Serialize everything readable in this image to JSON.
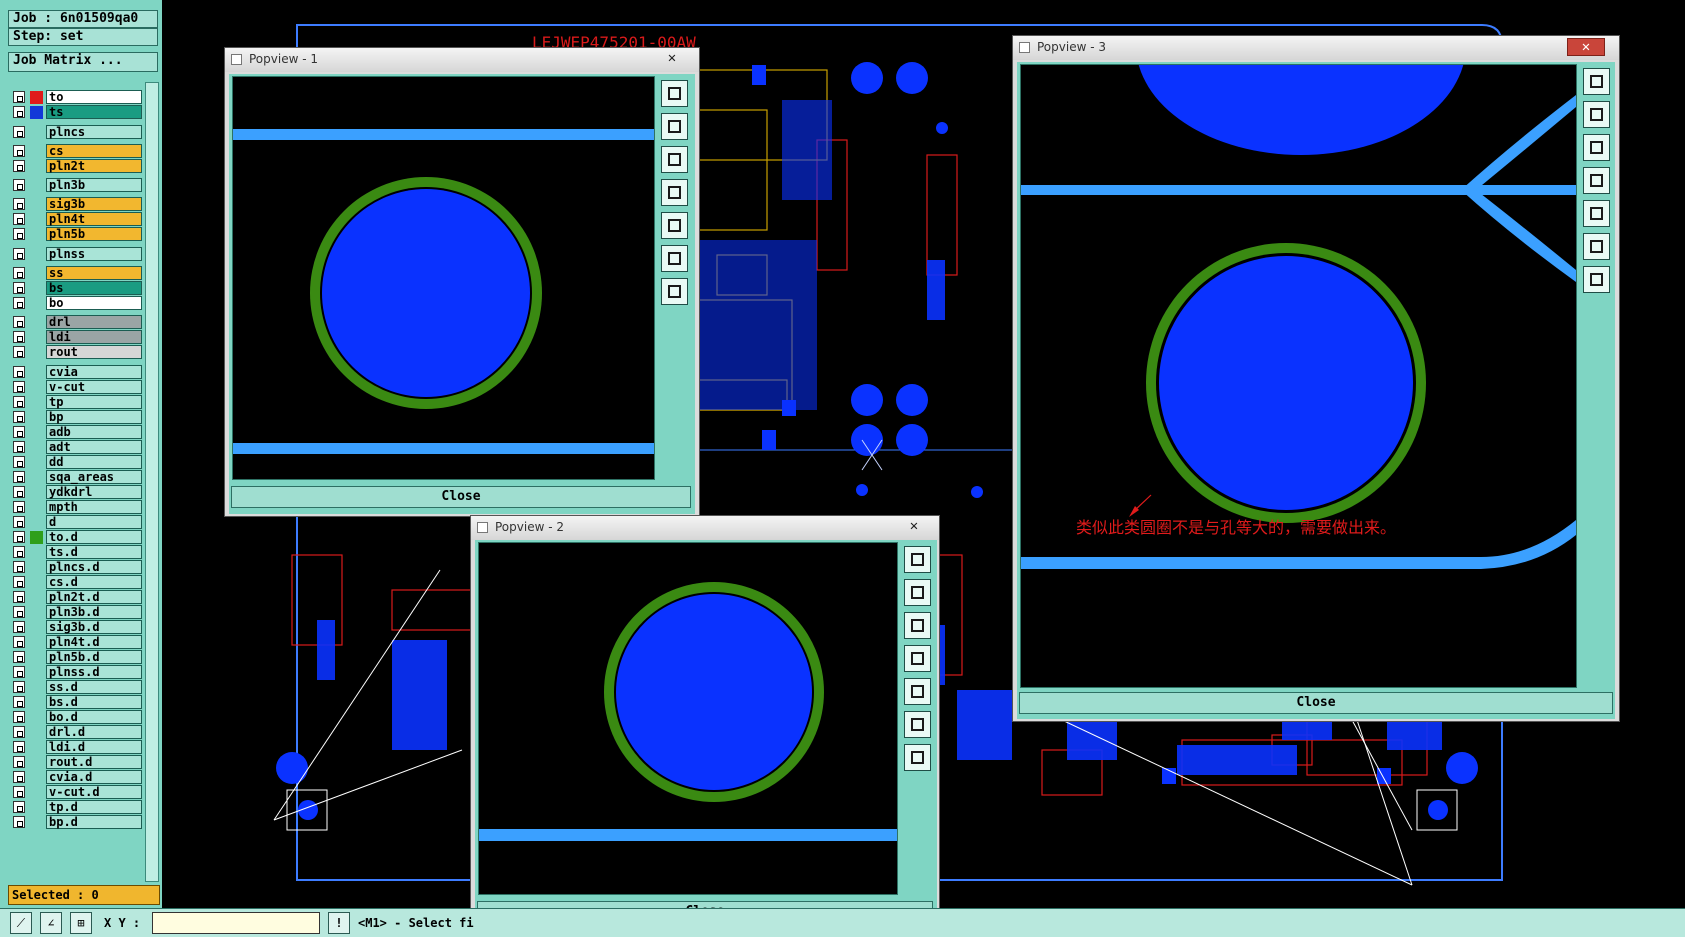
{
  "job": {
    "label": "Job : 6n01509qa0",
    "step": "Step: set",
    "matrix_button": "Job Matrix ..."
  },
  "layers": [
    {
      "name": "to",
      "color": "#ffffff",
      "swatch": "#e01b1b"
    },
    {
      "name": "ts",
      "color": "#1a9c82",
      "swatch": "#1238d8"
    },
    {
      "name": "plncs",
      "color": "#a9e4d7",
      "swatch": ""
    },
    {
      "name": "cs",
      "color": "#f2b72f",
      "swatch": ""
    },
    {
      "name": "pln2t",
      "color": "#f2b72f",
      "swatch": ""
    },
    {
      "name": "pln3b",
      "color": "#a9e4d7",
      "swatch": ""
    },
    {
      "name": "sig3b",
      "color": "#f2b72f",
      "swatch": ""
    },
    {
      "name": "pln4t",
      "color": "#f2b72f",
      "swatch": ""
    },
    {
      "name": "pln5b",
      "color": "#f2b72f",
      "swatch": ""
    },
    {
      "name": "plnss",
      "color": "#a9e4d7",
      "swatch": ""
    },
    {
      "name": "ss",
      "color": "#f2b72f",
      "swatch": ""
    },
    {
      "name": "bs",
      "color": "#1a9c82",
      "swatch": ""
    },
    {
      "name": "bo",
      "color": "#ffffff",
      "swatch": ""
    },
    {
      "name": "drl",
      "color": "#9aa5a5",
      "swatch": ""
    },
    {
      "name": "ldi",
      "color": "#9aa5a5",
      "swatch": ""
    },
    {
      "name": "rout",
      "color": "#d6d6d6",
      "swatch": ""
    },
    {
      "name": "cvia",
      "color": "#a9e4d7",
      "swatch": ""
    },
    {
      "name": "v-cut",
      "color": "#a9e4d7",
      "swatch": ""
    },
    {
      "name": "tp",
      "color": "#a9e4d7",
      "swatch": ""
    },
    {
      "name": "bp",
      "color": "#a9e4d7",
      "swatch": ""
    },
    {
      "name": "adb",
      "color": "#a9e4d7",
      "swatch": ""
    },
    {
      "name": "adt",
      "color": "#a9e4d7",
      "swatch": ""
    },
    {
      "name": "dd",
      "color": "#a9e4d7",
      "swatch": ""
    },
    {
      "name": "sqa_areas",
      "color": "#a9e4d7",
      "swatch": ""
    },
    {
      "name": "ydkdrl",
      "color": "#a9e4d7",
      "swatch": ""
    },
    {
      "name": "mpth",
      "color": "#a9e4d7",
      "swatch": ""
    },
    {
      "name": "d",
      "color": "#a9e4d7",
      "swatch": ""
    },
    {
      "name": "to.d",
      "color": "#a9e4d7",
      "swatch": "#2f9f1a"
    },
    {
      "name": "ts.d",
      "color": "#a9e4d7",
      "swatch": ""
    },
    {
      "name": "plncs.d",
      "color": "#a9e4d7",
      "swatch": ""
    },
    {
      "name": "cs.d",
      "color": "#a9e4d7",
      "swatch": ""
    },
    {
      "name": "pln2t.d",
      "color": "#a9e4d7",
      "swatch": ""
    },
    {
      "name": "pln3b.d",
      "color": "#a9e4d7",
      "swatch": ""
    },
    {
      "name": "sig3b.d",
      "color": "#a9e4d7",
      "swatch": ""
    },
    {
      "name": "pln4t.d",
      "color": "#a9e4d7",
      "swatch": ""
    },
    {
      "name": "pln5b.d",
      "color": "#a9e4d7",
      "swatch": ""
    },
    {
      "name": "plnss.d",
      "color": "#a9e4d7",
      "swatch": ""
    },
    {
      "name": "ss.d",
      "color": "#a9e4d7",
      "swatch": ""
    },
    {
      "name": "bs.d",
      "color": "#a9e4d7",
      "swatch": ""
    },
    {
      "name": "bo.d",
      "color": "#a9e4d7",
      "swatch": ""
    },
    {
      "name": "drl.d",
      "color": "#a9e4d7",
      "swatch": ""
    },
    {
      "name": "ldi.d",
      "color": "#a9e4d7",
      "swatch": ""
    },
    {
      "name": "rout.d",
      "color": "#a9e4d7",
      "swatch": ""
    },
    {
      "name": "cvia.d",
      "color": "#a9e4d7",
      "swatch": ""
    },
    {
      "name": "v-cut.d",
      "color": "#a9e4d7",
      "swatch": ""
    },
    {
      "name": "tp.d",
      "color": "#a9e4d7",
      "swatch": ""
    },
    {
      "name": "bp.d",
      "color": "#a9e4d7",
      "swatch": ""
    }
  ],
  "selected": "Selected : 0",
  "statusbar": {
    "xy_label": "X Y :",
    "xy_value": "",
    "message": "<M1> - Select fi"
  },
  "board": {
    "part_number": "LEJWEP475201-00AW"
  },
  "popups": [
    {
      "title": "Popview - 1",
      "close_label": "Close"
    },
    {
      "title": "Popview - 2",
      "close_label": "Close"
    },
    {
      "title": "Popview - 3",
      "close_label": "Close",
      "annotation": "类似此类圆圈不是与孔等大的，需要做出来。"
    }
  ],
  "colors": {
    "pad_blue": "#0a32ff",
    "trace_blue": "#3ba0ff",
    "ring_green": "#3a8a12",
    "outline_red": "#d91a1a",
    "silk_yellow": "#c8a000",
    "panel_teal": "#7fd5c3"
  },
  "icons": [
    "zoom-fit-icon",
    "pan-up-icon",
    "pan-down-icon",
    "pan-left-icon",
    "pan-right-icon",
    "zoom-in-icon",
    "zoom-out-icon"
  ]
}
